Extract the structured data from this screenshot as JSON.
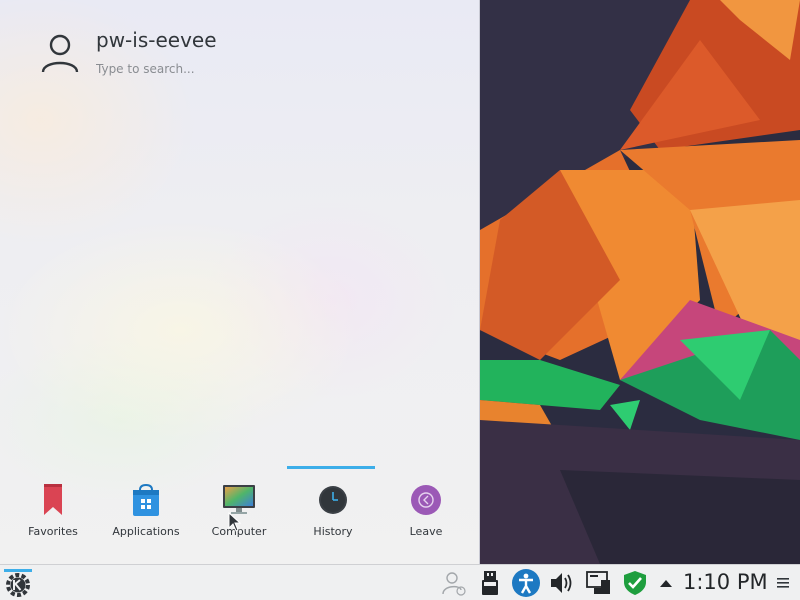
{
  "launcher": {
    "username": "pw-is-eevee",
    "search_placeholder": "Type to search...",
    "tabs": [
      {
        "label": "Favorites",
        "icon": "bookmark-icon"
      },
      {
        "label": "Applications",
        "icon": "applications-grid-icon"
      },
      {
        "label": "Computer",
        "icon": "computer-monitor-icon"
      },
      {
        "label": "History",
        "icon": "clock-icon",
        "active": true
      },
      {
        "label": "Leave",
        "icon": "leave-icon"
      }
    ]
  },
  "taskbar": {
    "launcher_icon": "kde-gear-icon",
    "tray_icons": [
      "user-switch-icon",
      "usb-drive-icon",
      "accessibility-icon",
      "volume-icon",
      "network-icon",
      "shield-check-icon",
      "expand-tray-arrow-icon"
    ],
    "clock": "1:10 PM",
    "menu_icon": "hamburger-menu-icon"
  },
  "colors": {
    "accent": "#3daee9",
    "favorites": "#da4453",
    "leave": "#9b59b6",
    "shield": "#1e9e3e"
  }
}
